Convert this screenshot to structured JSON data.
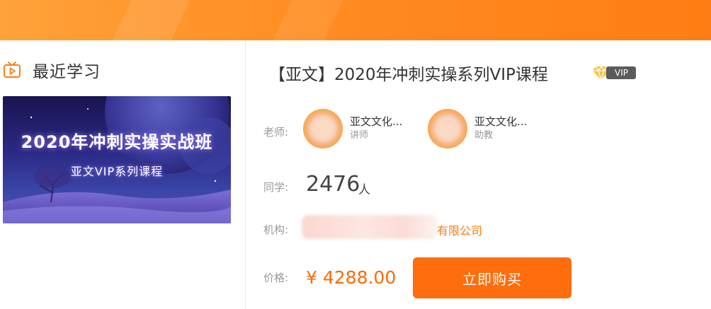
{
  "recent": {
    "title": "最近学习",
    "thumbnail": {
      "title": "2020年冲刺实操实战班",
      "subtitle": "亚文VIP系列课程"
    }
  },
  "course": {
    "title": "【亚文】2020年冲刺实操系列VIP课程",
    "vip_badge": "VIP",
    "teacher_label": "老师:",
    "teachers": [
      {
        "name": "亚文文化...",
        "role": "讲师"
      },
      {
        "name": "亚文文化...",
        "role": "助教"
      }
    ],
    "students_label": "同学:",
    "students_count": "2476",
    "students_unit": "人",
    "org_label": "机构:",
    "org_name_suffix": "有限公司",
    "price_label": "价格:",
    "price": "¥ 4288.00",
    "buy_label": "立即购买"
  },
  "colors": {
    "accent": "#ff6d0c",
    "banner": "#ff8a1f",
    "price": "#ff6a00",
    "vip_badge_bg": "#5b5b5b",
    "vip_diamond": "#f5c242"
  },
  "icons": {
    "recent": "tv-play-icon",
    "vip": "diamond-icon"
  }
}
